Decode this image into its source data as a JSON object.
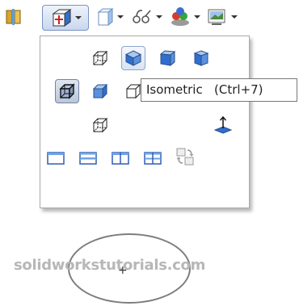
{
  "toolbar": {
    "buttons": [
      {
        "icon": "section-view-icon"
      },
      {
        "icon": "view-orientation-icon",
        "has_dropdown": true,
        "pressed": true
      },
      {
        "icon": "display-style-icon",
        "has_dropdown": true
      },
      {
        "icon": "hide-show-items-icon",
        "has_dropdown": true
      },
      {
        "icon": "edit-appearance-icon",
        "has_dropdown": true
      },
      {
        "icon": "apply-scene-icon",
        "has_dropdown": true
      }
    ]
  },
  "flyout": {
    "rows": [
      [
        "front-view-icon",
        "isometric-view-icon",
        "trimetric-view-icon",
        "dimetric-view-icon"
      ],
      [
        "current-view-icon",
        "left-view-icon",
        "back-view-icon",
        "right-view-icon"
      ],
      [
        "bottom-view-icon",
        "normal-to-icon"
      ],
      [
        "single-view-icon",
        "two-view-horizontal-icon",
        "two-view-vertical-icon",
        "four-view-icon",
        "link-views-icon"
      ]
    ],
    "hovered": "isometric-view-icon",
    "selected": "current-view-icon"
  },
  "tooltip": {
    "text": "Isometric   (Ctrl+7)"
  },
  "canvas": {
    "watermark": "solidworkstutorials.com",
    "cursor": "+"
  },
  "colors": {
    "accent": "#2f6fcf",
    "watermark": "#b7b7b7",
    "ellipse": "#7d7d7d"
  }
}
